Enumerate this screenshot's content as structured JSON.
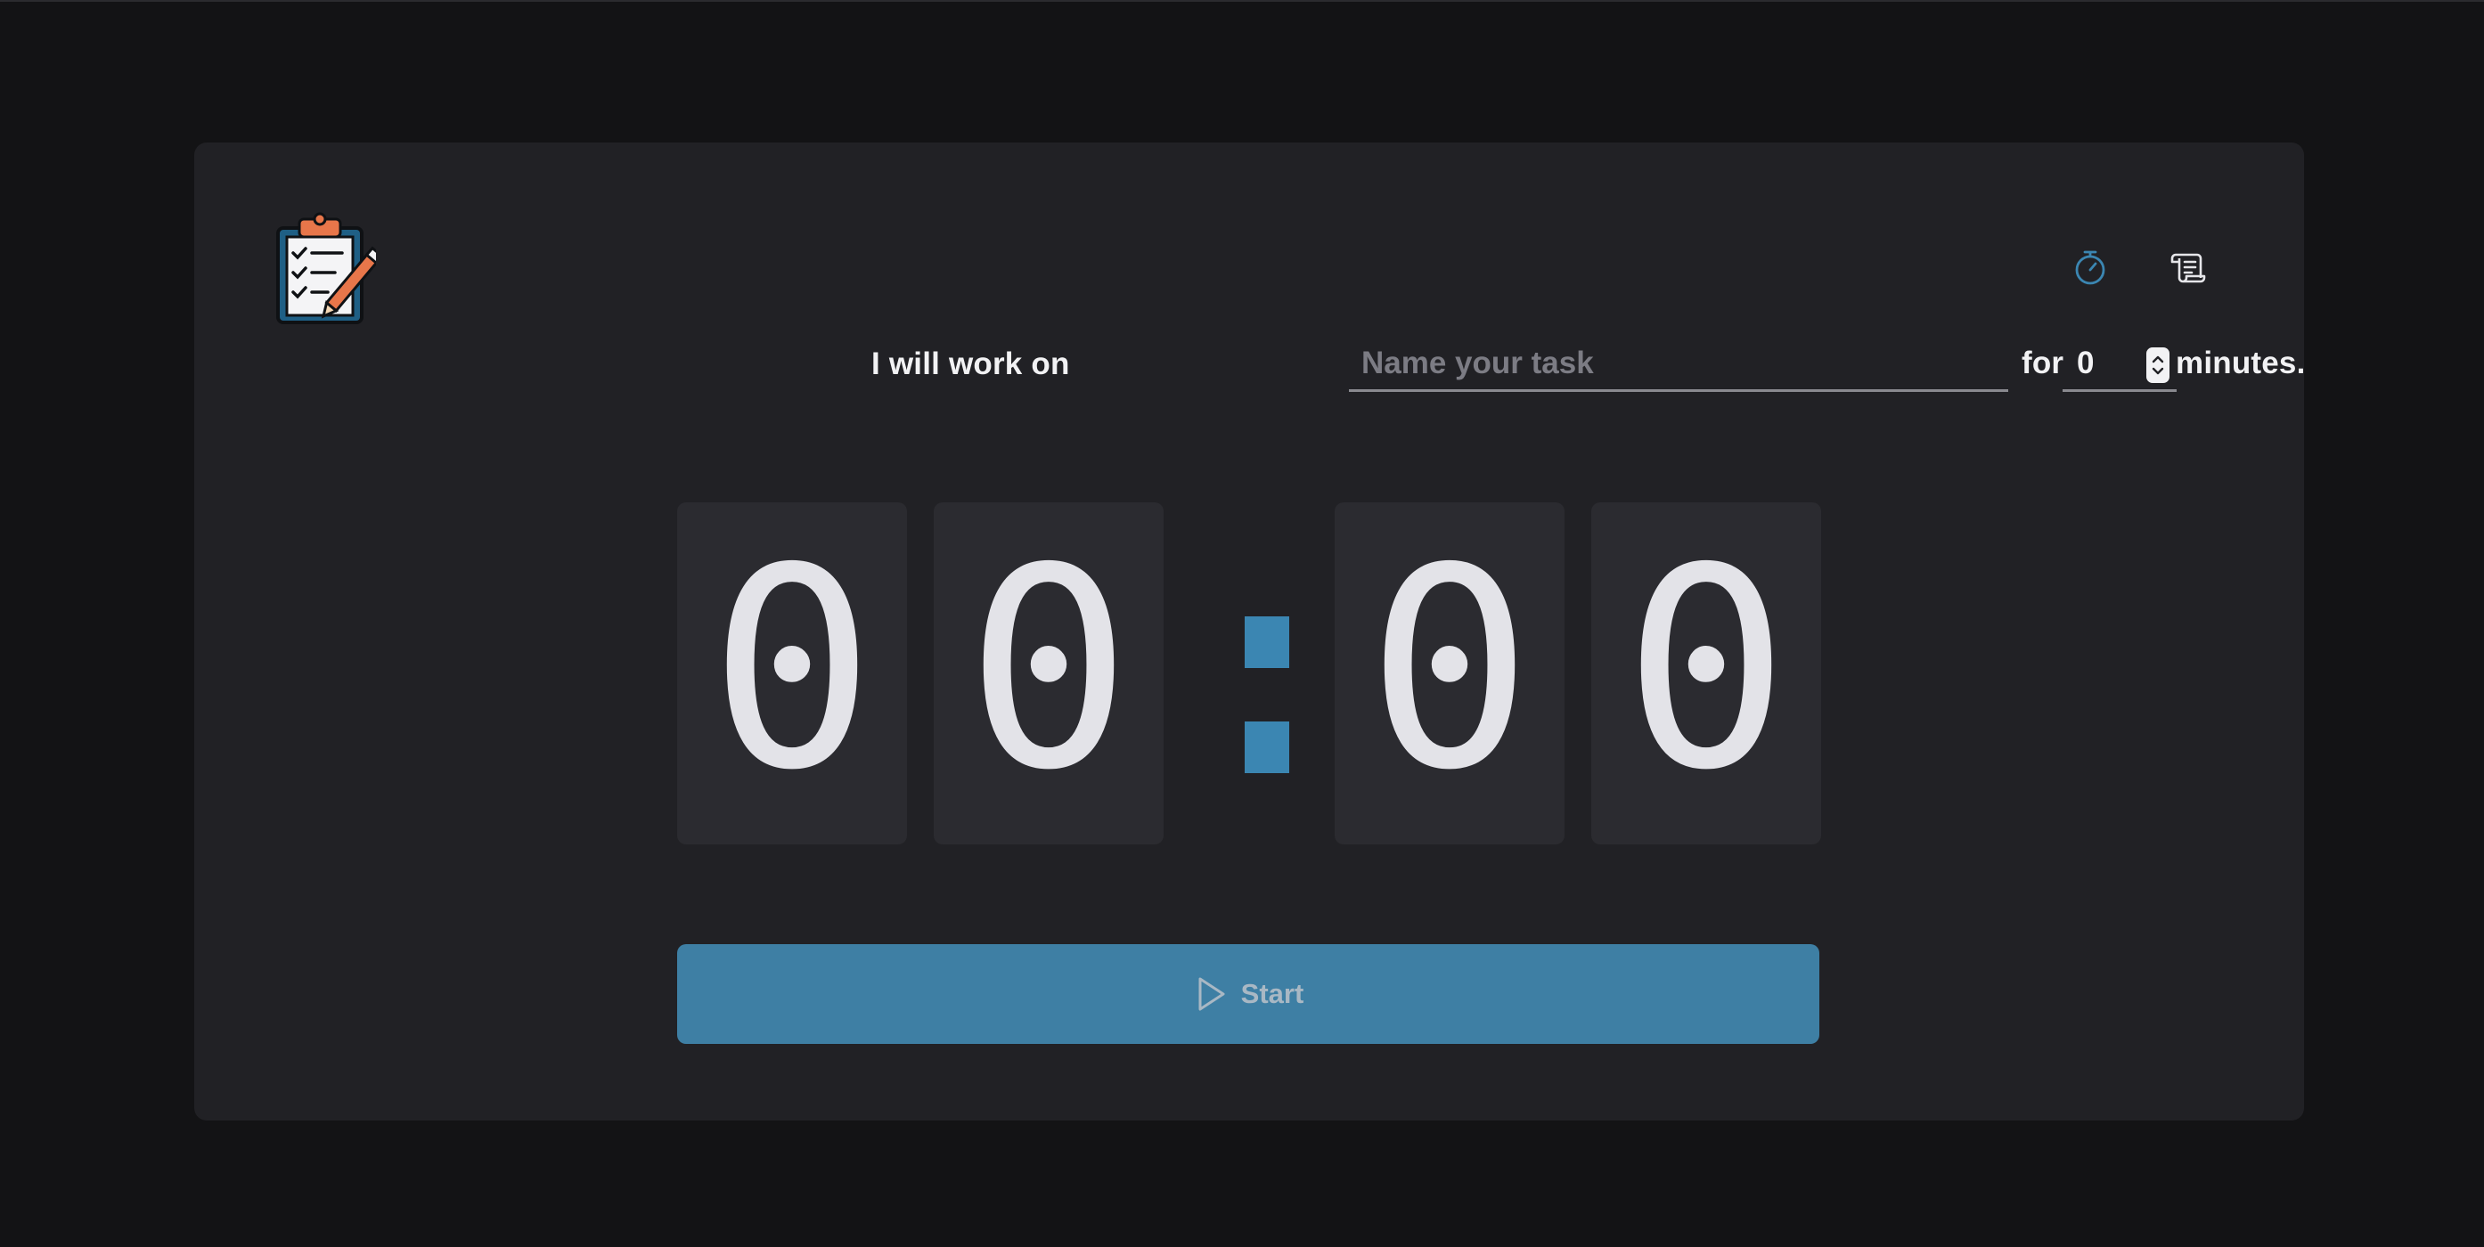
{
  "app": {
    "logo_icon": "clipboard-checklist-pencil-icon"
  },
  "header": {
    "timer_icon": "stopwatch-icon",
    "log_icon": "scroll-log-icon",
    "active_color": "#3b86b2"
  },
  "task": {
    "prefix_label": "I will work on",
    "input_value": "",
    "input_placeholder": "Name your task",
    "for_label": "for",
    "minutes_value": "0",
    "suffix_label": "minutes."
  },
  "timer": {
    "digits": [
      "0",
      "0",
      "0",
      "0"
    ],
    "separator_color": "#3b86b2"
  },
  "start_button": {
    "label": "Start",
    "icon": "play-icon",
    "color": "#3e7fa4"
  }
}
